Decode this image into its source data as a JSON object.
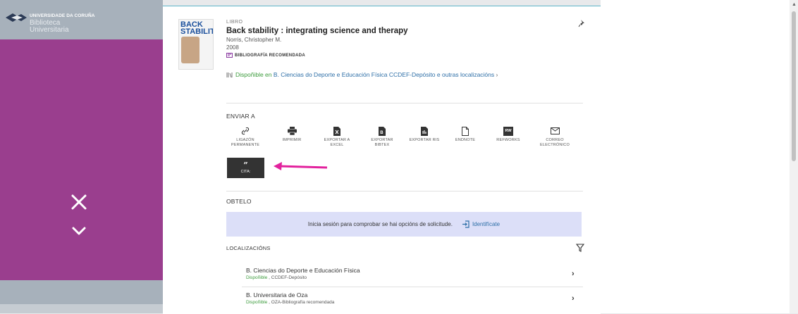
{
  "left": {
    "logo_line1": "UNIVERSIDADE DA CORUÑA",
    "logo_line2": "Biblioteca",
    "logo_line3": "Universitaria",
    "accent_color": "#9a3e8e"
  },
  "record": {
    "type": "LIBRO",
    "title": "Back stability : integrating science and therapy",
    "author": "Norris, Christopher M.",
    "year": "2008",
    "badge": "BIBLIOGRAFÍA RECOMENDADA",
    "cover_title": "BACK STABILITY",
    "availability_status": "Dispoñible en",
    "availability_location": "B. Ciencias do Deporte e Educación Física",
    "availability_shelf": "CCDEF-Depósito e outras localizacións",
    "availability_chevron": "›"
  },
  "send": {
    "heading": "ENVIAR A",
    "actions": [
      {
        "label": "LIGAZÓN PERMANENTE",
        "icon": "link-icon"
      },
      {
        "label": "IMPRIMIR",
        "icon": "print-icon"
      },
      {
        "label": "EXPORTAR A EXCEL",
        "icon": "excel-icon"
      },
      {
        "label": "EXPORTAR BIBTEX",
        "icon": "bibtex-icon"
      },
      {
        "label": "EXPORTAR RIS",
        "icon": "ris-icon"
      },
      {
        "label": "ENDNOTE",
        "icon": "endnote-icon"
      },
      {
        "label": "REFWORKS",
        "icon": "refworks-icon"
      },
      {
        "label": "CORREO ELECTRÓNICO",
        "icon": "email-icon"
      }
    ],
    "cite_quote": "”",
    "cite_label": "CITA:",
    "refworks_badge": "RW"
  },
  "get": {
    "heading": "OBTELO",
    "login_message": "Inicia sesión para comprobar se hai opcións de solicitude.",
    "login_link": "Identifícate"
  },
  "locations": {
    "heading": "LOCALIZACIÓNS",
    "items": [
      {
        "name": "B. Ciencias do Deporte e Educación Física",
        "status": "Dispoñible",
        "shelf": " , CCDEF-Depósito"
      },
      {
        "name": "B. Universitaria de Oza",
        "status": "Dispoñible",
        "shelf": " , OZA-Bibliografía recomendada"
      }
    ]
  }
}
